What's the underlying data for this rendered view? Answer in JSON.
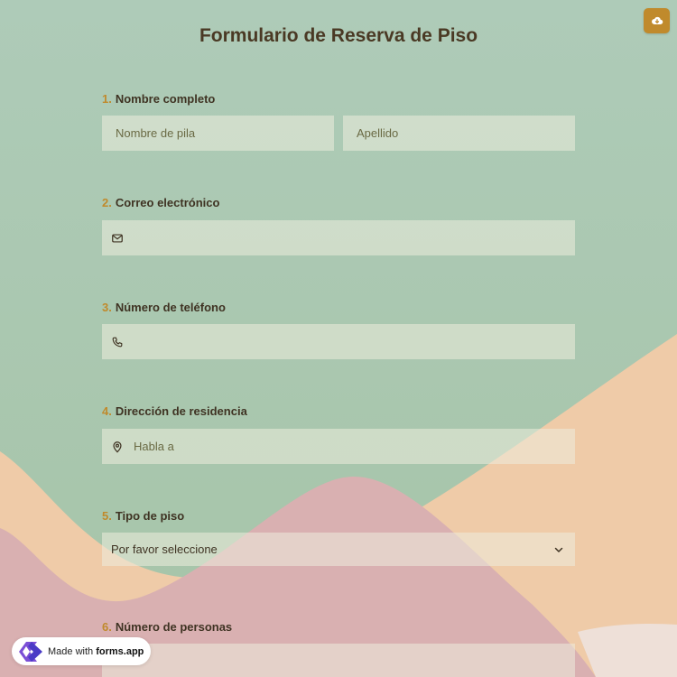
{
  "form": {
    "title": "Formulario de Reserva de Piso",
    "save_icon": "cloud-download-icon",
    "questions": [
      {
        "number": "1.",
        "label": "Nombre completo",
        "first_placeholder": "Nombre de pila",
        "last_placeholder": "Apellido"
      },
      {
        "number": "2.",
        "label": "Correo electrónico",
        "icon": "mail-icon"
      },
      {
        "number": "3.",
        "label": "Número de teléfono",
        "icon": "phone-icon"
      },
      {
        "number": "4.",
        "label": "Dirección de residencia",
        "icon": "location-pin-icon",
        "placeholder": "Habla a"
      },
      {
        "number": "5.",
        "label": "Tipo de piso",
        "selected": "Por favor seleccione",
        "icon": "chevron-down-icon"
      },
      {
        "number": "6.",
        "label": "Número de personas"
      }
    ]
  },
  "badge": {
    "prefix": "Made with",
    "brand": "forms.app",
    "logo": "forms-app-logo"
  },
  "colors": {
    "accent": "#c08a2c",
    "title": "#4a3924",
    "label": "#3f3323",
    "background_green": "#a8c6b0",
    "background_peach": "#eecaa6",
    "background_pink": "#d9afb0"
  }
}
